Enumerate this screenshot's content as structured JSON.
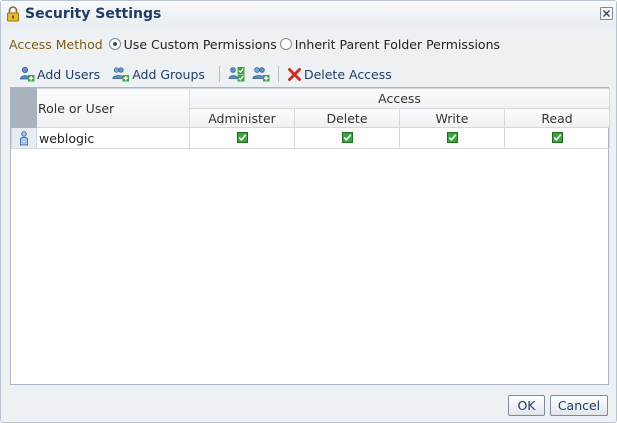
{
  "dialog": {
    "title": "Security Settings",
    "access_method": {
      "label": "Access Method",
      "options": [
        {
          "label": "Use Custom Permissions",
          "selected": true
        },
        {
          "label": "Inherit Parent Folder Permissions",
          "selected": false
        }
      ]
    },
    "toolbar": {
      "add_users": "Add Users",
      "add_groups": "Add Groups",
      "delete_access": "Delete Access"
    },
    "table": {
      "role_header": "Role or User",
      "access_header": "Access",
      "columns": [
        "Administer",
        "Delete",
        "Write",
        "Read"
      ],
      "rows": [
        {
          "name": "weblogic",
          "administer": true,
          "delete": true,
          "write": true,
          "read": true
        }
      ]
    },
    "buttons": {
      "ok": "OK",
      "cancel": "Cancel"
    },
    "colors": {
      "title": "#1f3c64",
      "access_label": "#7a5a15",
      "check": "#2f9e2f"
    }
  }
}
